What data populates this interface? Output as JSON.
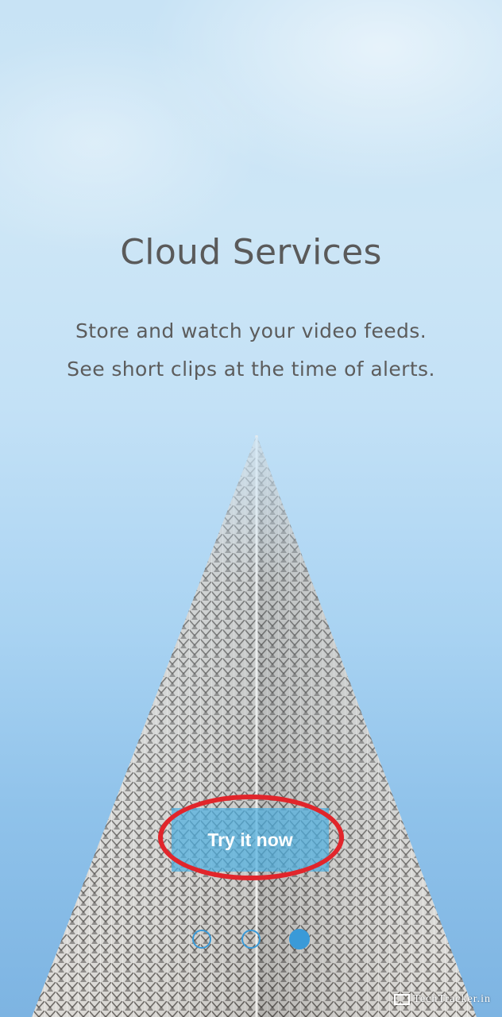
{
  "onboarding": {
    "title": "Cloud Services",
    "subtitle_line_1": "Store and watch your video feeds.",
    "subtitle_line_2": "See short clips at the time of alerts.",
    "cta_label": "Try it now",
    "page_indicator": {
      "total": 3,
      "current": 3
    }
  },
  "watermark": {
    "text": "TechTracker.in"
  },
  "colors": {
    "title_text": "#5a5a5a",
    "cta_background": "#4fb0e0",
    "cta_text": "#ffffff",
    "page_indicator": "#3a9ad8",
    "highlight_ring": "#e1252b"
  }
}
